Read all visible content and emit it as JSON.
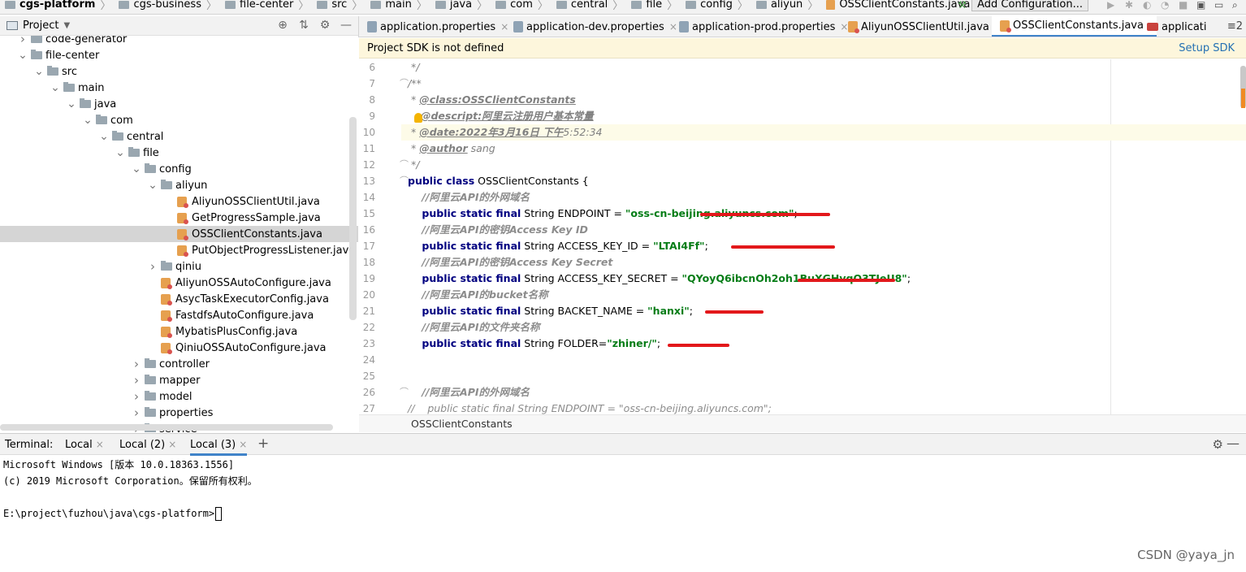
{
  "breadcrumb": [
    {
      "label": "cgs-platform",
      "bold": true
    },
    {
      "label": "cgs-business"
    },
    {
      "label": "file-center"
    },
    {
      "label": "src"
    },
    {
      "label": "main"
    },
    {
      "label": "java"
    },
    {
      "label": "com"
    },
    {
      "label": "central"
    },
    {
      "label": "file"
    },
    {
      "label": "config"
    },
    {
      "label": "aliyun"
    },
    {
      "label": "OSSClientConstants.java"
    }
  ],
  "toolbar": {
    "add_configuration": "Add Configuration..."
  },
  "project_panel": {
    "title": "Project"
  },
  "tree": [
    {
      "label": "code-generator",
      "kind": "folder",
      "indent": 1,
      "arrow": "right"
    },
    {
      "label": "file-center",
      "kind": "folder",
      "indent": 1,
      "arrow": "down"
    },
    {
      "label": "src",
      "kind": "folder",
      "indent": 2,
      "arrow": "down"
    },
    {
      "label": "main",
      "kind": "folder",
      "indent": 3,
      "arrow": "down"
    },
    {
      "label": "java",
      "kind": "folder",
      "indent": 4,
      "arrow": "down"
    },
    {
      "label": "com",
      "kind": "folder",
      "indent": 5,
      "arrow": "down"
    },
    {
      "label": "central",
      "kind": "folder",
      "indent": 6,
      "arrow": "down"
    },
    {
      "label": "file",
      "kind": "folder",
      "indent": 7,
      "arrow": "down"
    },
    {
      "label": "config",
      "kind": "folder",
      "indent": 8,
      "arrow": "down"
    },
    {
      "label": "aliyun",
      "kind": "folder",
      "indent": 9,
      "arrow": "down"
    },
    {
      "label": "AliyunOSSClientUtil.java",
      "kind": "java",
      "indent": 10
    },
    {
      "label": "GetProgressSample.java",
      "kind": "java",
      "indent": 10
    },
    {
      "label": "OSSClientConstants.java",
      "kind": "java",
      "indent": 10,
      "selected": true
    },
    {
      "label": "PutObjectProgressListener.java",
      "kind": "java",
      "indent": 10
    },
    {
      "label": "qiniu",
      "kind": "folder",
      "indent": 9,
      "arrow": "right"
    },
    {
      "label": "AliyunOSSAutoConfigure.java",
      "kind": "java",
      "indent": 9
    },
    {
      "label": "AsycTaskExecutorConfig.java",
      "kind": "java",
      "indent": 9
    },
    {
      "label": "FastdfsAutoConfigure.java",
      "kind": "java",
      "indent": 9
    },
    {
      "label": "MybatisPlusConfig.java",
      "kind": "java",
      "indent": 9
    },
    {
      "label": "QiniuOSSAutoConfigure.java",
      "kind": "java",
      "indent": 9
    },
    {
      "label": "controller",
      "kind": "folder",
      "indent": 8,
      "arrow": "right"
    },
    {
      "label": "mapper",
      "kind": "folder",
      "indent": 8,
      "arrow": "right"
    },
    {
      "label": "model",
      "kind": "folder",
      "indent": 8,
      "arrow": "right"
    },
    {
      "label": "properties",
      "kind": "folder",
      "indent": 8,
      "arrow": "right"
    },
    {
      "label": "service",
      "kind": "folder",
      "indent": 8,
      "arrow": "right"
    }
  ],
  "tabs": [
    {
      "label": "application.properties",
      "icon": "props"
    },
    {
      "label": "application-dev.properties",
      "icon": "props"
    },
    {
      "label": "application-prod.properties",
      "icon": "props"
    },
    {
      "label": "AliyunOSSClientUtil.java",
      "icon": "java"
    },
    {
      "label": "OSSClientConstants.java",
      "icon": "java",
      "active": true
    },
    {
      "label": "applicati",
      "icon": "yml"
    }
  ],
  "tabs_more": "≡2",
  "banner": {
    "message": "Project SDK is not defined",
    "action": "Setup SDK"
  },
  "code": {
    "line_numbers": [
      "6",
      "7",
      "8",
      "9",
      "10",
      "11",
      "12",
      "13",
      "14",
      "15",
      "16",
      "17",
      "18",
      "19",
      "20",
      "21",
      "22",
      "23",
      "24",
      "25",
      "26",
      "27"
    ],
    "l6": " */",
    "l7": "/**",
    "l8_star": " * ",
    "l8_tag": "@class:OSSClientConstants",
    "l9_star": " ",
    "l9_tag": "@descript:阿里云注册用户基本常量",
    "l10_star": " * ",
    "l10_tag": "@date:2022年3月16日 下午",
    "l10_rest": "5:52:34",
    "l11_star": " * ",
    "l11_tag": "@author",
    "l11_rest": " sang",
    "l12": " */",
    "l13_kw": "public class",
    "l13_rest": " OSSClientConstants {",
    "l14": "    //阿里云API的外网域名",
    "l15_kw": "    public static final",
    "l15_type": " String ENDPOINT = ",
    "l15_str": "\"oss-cn-beijing.aliyuncs.com\"",
    "l15_end": ";",
    "l16": "    //阿里云API的密钥Access Key ID",
    "l17_kw": "    public static final",
    "l17_type": " String ACCESS_KEY_ID = ",
    "l17_str": "\"LTAI4Ff\"",
    "l17_end": ";",
    "l18": "    //阿里云API的密钥Access Key Secret",
    "l19_kw": "    public static final",
    "l19_type": " String ACCESS_KEY_SECRET = ",
    "l19_str": "\"QYoyQ6ibcnOh2oh1BuXGHvqO3TJeU8\"",
    "l19_end": ";",
    "l20": "    //阿里云API的bucket名称",
    "l21_kw": "    public static final",
    "l21_type": " String BACKET_NAME = ",
    "l21_str": "\"hanxi\"",
    "l21_end": ";",
    "l22": "    //阿里云API的文件夹名称",
    "l23_kw": "    public static final",
    "l23_type": " String FOLDER=",
    "l23_str": "\"zhiner/\"",
    "l23_end": ";",
    "l26": "    //阿里云API的外网域名",
    "l27": "//    public static final String ENDPOINT = \"oss-cn-beijing.aliyuncs.com\";"
  },
  "editor_footer": "OSSClientConstants",
  "terminal": {
    "label": "Terminal:",
    "tabs": [
      "Local",
      "Local (2)",
      "Local (3)"
    ],
    "active_tab": "Local (3)",
    "lines": [
      "Microsoft Windows [版本 10.0.18363.1556]",
      "(c) 2019 Microsoft Corporation。保留所有权利。",
      "",
      "E:\\project\\fuzhou\\java\\cgs-platform>"
    ]
  },
  "watermark": "CSDN @yaya_jn",
  "colors": {
    "accent": "#4083c9",
    "banner_bg": "#fdf6dc",
    "keyword": "#000080",
    "string": "#067d17",
    "redaction": "#e3181b"
  }
}
